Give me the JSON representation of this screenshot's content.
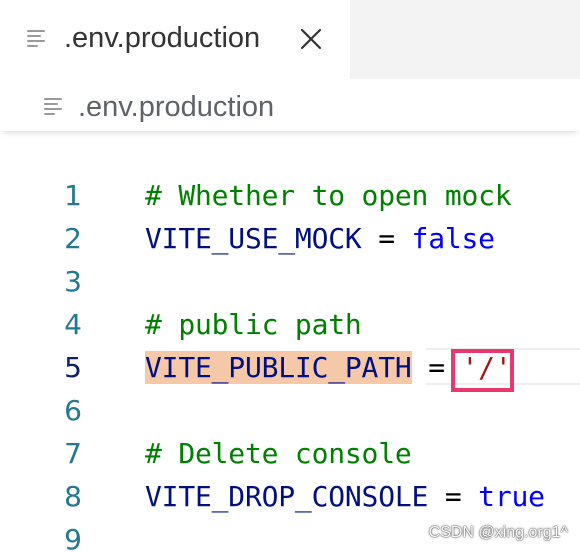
{
  "tab": {
    "title": ".env.production",
    "icon": "lines-icon",
    "close_icon": "close-icon"
  },
  "breadcrumb": {
    "file": ".env.production",
    "icon": "lines-icon"
  },
  "editor": {
    "active_line": 5,
    "lines": [
      {
        "number": "1",
        "comment": "# Whether to open mock"
      },
      {
        "number": "2",
        "key": "VITE_USE_MOCK",
        "op": " = ",
        "value": "false"
      },
      {
        "number": "3"
      },
      {
        "number": "4",
        "comment": "# public path"
      },
      {
        "number": "5",
        "key": "VITE_PUBLIC_PATH",
        "op": " = ",
        "value": "'/'"
      },
      {
        "number": "6"
      },
      {
        "number": "7",
        "comment": "# Delete console"
      },
      {
        "number": "8",
        "key": "VITE_DROP_CONSOLE",
        "op": " = ",
        "value": "true"
      },
      {
        "number": "9"
      }
    ]
  },
  "watermark": "CSDN @xing.org1^",
  "colors": {
    "comment": "#008000",
    "key": "#001080",
    "boolean": "#0000ff",
    "string": "#a31515",
    "line_number": "#237893",
    "highlight": "#f5c8a8",
    "annotation": "#e8386d"
  }
}
